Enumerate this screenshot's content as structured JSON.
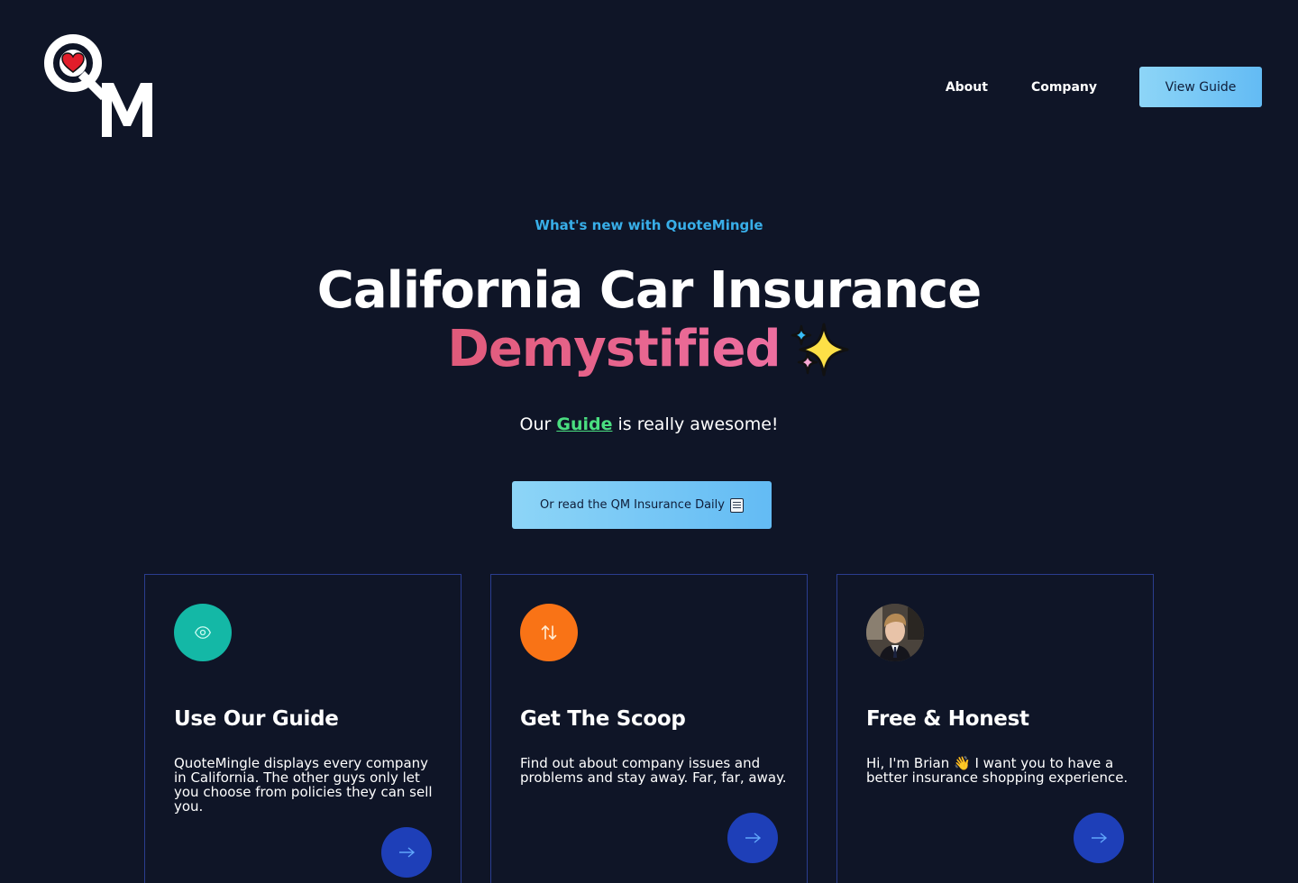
{
  "brand": {
    "logo_text": "QM",
    "logo_icon": "heart-icon"
  },
  "nav": {
    "about_label": "About",
    "company_label": "Company",
    "view_guide_label": "View Guide"
  },
  "hero": {
    "eyebrow": "What's new with QuoteMingle",
    "headline_line1": "California Car Insurance",
    "headline_accent": "Demystified",
    "headline_emoji": "sparkles-icon",
    "tagline_prefix": "Our ",
    "tagline_link": "Guide",
    "tagline_suffix": " is really awesome!",
    "daily_button_label": "Or read the QM Insurance Daily",
    "daily_button_icon": "newspaper-icon"
  },
  "cards": [
    {
      "icon": "eye-icon",
      "title": "Use Our Guide",
      "body": "QuoteMingle displays every company in California. The other guys only let you choose from policies they can sell you.",
      "action_icon": "arrow-right-icon"
    },
    {
      "icon": "arrows-up-down-icon",
      "title": "Get The Scoop",
      "body": "Find out about company issues and problems and stay away. Far, far, away.",
      "action_icon": "arrow-right-icon"
    },
    {
      "icon": "avatar",
      "title": "Free & Honest",
      "body_prefix": "Hi, I'm Brian ",
      "body_emoji": "👋",
      "body_suffix": " I want you to have a better insurance shopping experience.",
      "action_icon": "arrow-right-icon"
    }
  ],
  "colors": {
    "background": "#0f1527",
    "accent_blue": "#38aee8",
    "accent_pink": "#e05a7a",
    "link_green": "#4ade80",
    "card_border": "#2a3d8f",
    "teal": "#14b8a6",
    "orange": "#f97316",
    "action_blue": "#1e3fb8"
  }
}
